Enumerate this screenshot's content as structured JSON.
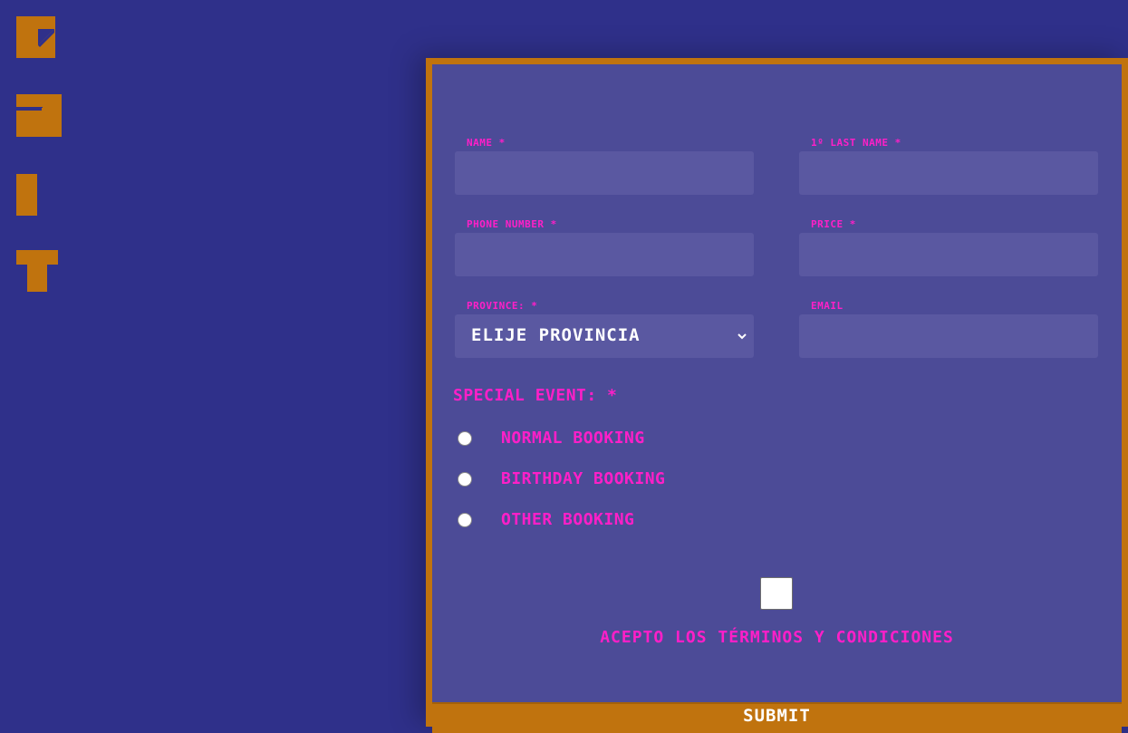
{
  "side_title": {
    "letters": [
      "E",
      "D",
      "I",
      "T"
    ]
  },
  "form": {
    "fields": {
      "name": {
        "label": "Name *",
        "value": ""
      },
      "last_name": {
        "label": "1º Last Name *",
        "value": ""
      },
      "phone": {
        "label": "Phone Number *",
        "value": ""
      },
      "price": {
        "label": "Price *",
        "value": ""
      },
      "province": {
        "label": "Province: *",
        "selected": "Elije provincia"
      },
      "email": {
        "label": "Email",
        "value": ""
      }
    },
    "special_event": {
      "title": "Special Event: *",
      "options": [
        {
          "label": "Normal Booking",
          "checked": false
        },
        {
          "label": "Birthday Booking",
          "checked": false
        },
        {
          "label": "Other Booking",
          "checked": false
        }
      ]
    },
    "terms": {
      "label": "Acepto los términos y condiciones",
      "checked": false
    },
    "submit_label": "Submit"
  },
  "colors": {
    "background": "#2f308a",
    "panel": "#4c4b97",
    "input": "#5a58a1",
    "accent": "#c0730e",
    "label": "#ff1fc8"
  },
  "icons": {
    "select_chevron": "chevron-down-icon"
  }
}
